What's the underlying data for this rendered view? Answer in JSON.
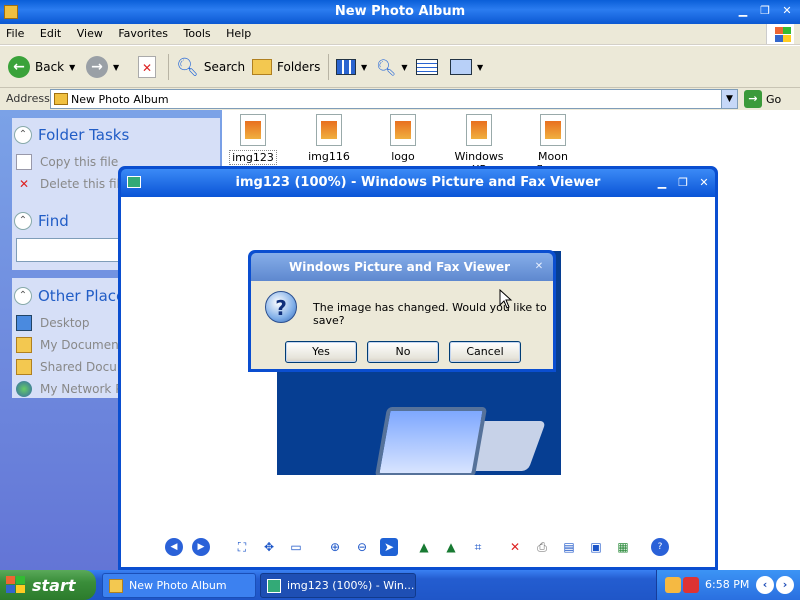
{
  "explorer": {
    "title": "New Photo Album",
    "menu": [
      "File",
      "Edit",
      "View",
      "Favorites",
      "Tools",
      "Help"
    ],
    "toolbar": {
      "back_label": "Back",
      "search_label": "Search",
      "folders_label": "Folders"
    },
    "address": {
      "label": "Address",
      "value": "New Photo Album",
      "go_label": "Go"
    },
    "left_pane": {
      "folder_tasks": {
        "title": "Folder Tasks",
        "items": [
          "Copy this file",
          "Delete this file"
        ]
      },
      "find": {
        "title": "Find"
      },
      "other_places": {
        "title": "Other Places",
        "items": [
          "Desktop",
          "My Documents",
          "Shared Documents",
          "My Network Places"
        ]
      }
    },
    "files": [
      {
        "name": "img123",
        "selected": true
      },
      {
        "name": "img116",
        "selected": false
      },
      {
        "name": "logo",
        "selected": false
      },
      {
        "name": "Windows XP",
        "selected": false
      },
      {
        "name": "Moon flower",
        "selected": false
      }
    ]
  },
  "viewer": {
    "title": "img123 (100%) - Windows Picture and Fax Viewer",
    "toolbar_icons": [
      "previous-image-icon",
      "next-image-icon",
      "best-fit-icon",
      "actual-size-icon",
      "slideshow-icon",
      "zoom-in-icon",
      "zoom-out-icon",
      "pointer-icon",
      "rotate-clockwise-icon",
      "rotate-counterclockwise-icon",
      "crop-icon",
      "delete-icon",
      "print-icon",
      "copy-to-icon",
      "save-icon",
      "edit-icon",
      "help-icon"
    ]
  },
  "dialog": {
    "title": "Windows Picture and Fax Viewer",
    "message": "The image has changed. Would you like to save?",
    "buttons": {
      "yes": "Yes",
      "no": "No",
      "cancel": "Cancel"
    }
  },
  "taskbar": {
    "start_label": "start",
    "tasks": [
      "New Photo Album",
      "img123 (100%) - Win..."
    ],
    "time": "6:58 PM"
  },
  "colors": {
    "xp_blue": "#0a4ed0",
    "start_green": "#3a8e3a",
    "panel_blue": "#7ba2e7",
    "dialog_face": "#ece9d8"
  }
}
